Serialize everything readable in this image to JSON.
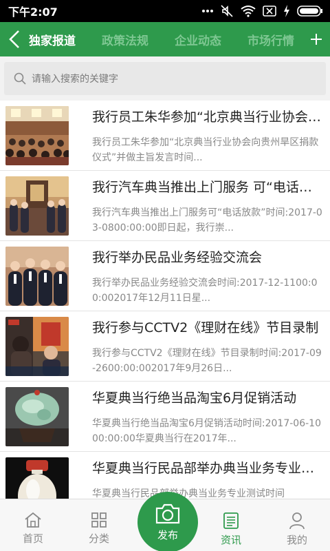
{
  "status_bar": {
    "time": "下午2:07"
  },
  "topnav": {
    "tabs": [
      {
        "label": "独家报道",
        "active": true
      },
      {
        "label": "政策法规",
        "active": false
      },
      {
        "label": "企业动态",
        "active": false
      },
      {
        "label": "市场行情",
        "active": false
      }
    ]
  },
  "search": {
    "placeholder": "请输入搜索的关键字"
  },
  "news": [
    {
      "title": "我行员工朱华参加“北京典当行业协会向贵州旱区捐款仪式”并做主旨发言",
      "summary": "我行员工朱华参加“北京典当行业协会向贵州旱区捐款仪式”并做主旨发言时间..."
    },
    {
      "title": "我行汽车典当推出上门服务 可“电话放款”",
      "summary": "我行汽车典当推出上门服务可“电话放款”时间:2017-03-0800:00:00即日起，我行崇..."
    },
    {
      "title": "我行举办民品业务经验交流会",
      "summary": "我行举办民品业务经验交流会时间:2017-12-1100:00:002017年12月11日星..."
    },
    {
      "title": "我行参与CCTV2《理财在线》节目录制",
      "summary": "我行参与CCTV2《理财在线》节目录制时间:2017-09-2600:00:002017年9月26日..."
    },
    {
      "title": "华夏典当行绝当品淘宝6月促销活动",
      "summary": "华夏典当行绝当品淘宝6月促销活动时间:2017-06-1000:00:00华夏典当行在2017年..."
    },
    {
      "title": "华夏典当行民品部举办典当业务专业测试",
      "summary": "华夏典当行民品部举办典当业务专业测试时间"
    }
  ],
  "bottom_nav": {
    "home": "首页",
    "category": "分类",
    "publish": "发布",
    "news": "资讯",
    "mine": "我的"
  },
  "colors": {
    "brand": "#2e9a4c",
    "tab_inactive": "#7ec792"
  }
}
